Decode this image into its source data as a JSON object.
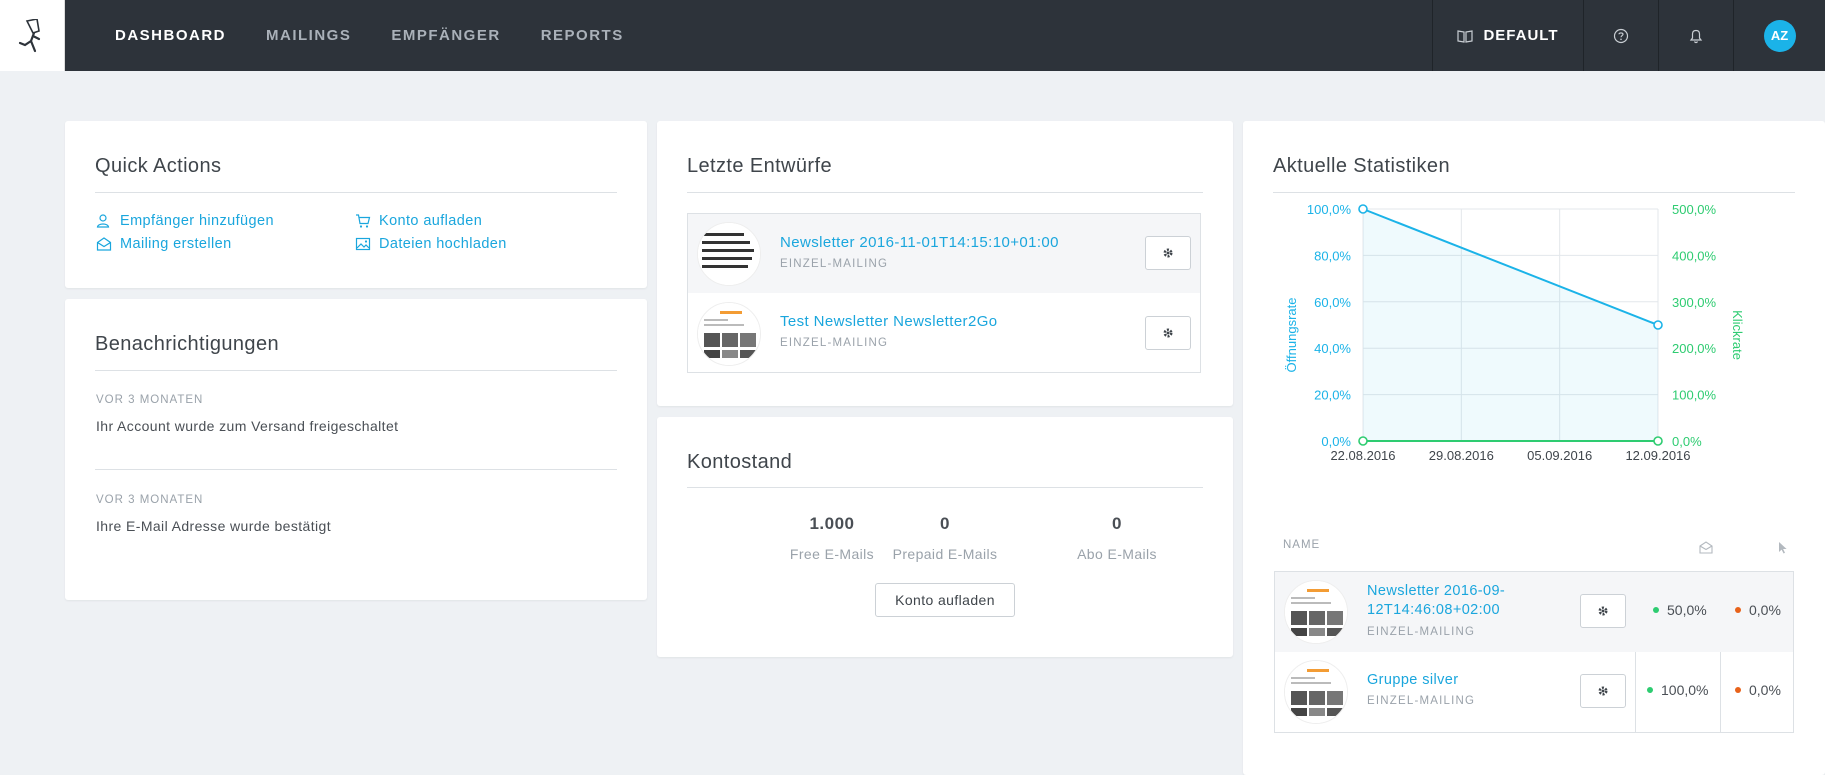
{
  "nav": {
    "items": [
      {
        "label": "DASHBOARD",
        "active": true
      },
      {
        "label": "MAILINGS",
        "active": false
      },
      {
        "label": "EMPFÄNGER",
        "active": false
      },
      {
        "label": "REPORTS",
        "active": false
      }
    ],
    "workspace_label": "DEFAULT",
    "avatar_initials": "AZ"
  },
  "quick_actions": {
    "title": "Quick Actions",
    "links": {
      "add_recipient": "Empfänger hinzufügen",
      "create_mailing": "Mailing erstellen",
      "topup": "Konto aufladen",
      "upload": "Dateien hochladen"
    }
  },
  "notifications": {
    "title": "Benachrichtigungen",
    "items": [
      {
        "time": "VOR 3 MONATEN",
        "text": "Ihr Account wurde zum Versand freigeschaltet"
      },
      {
        "time": "VOR 3 MONATEN",
        "text": "Ihre E-Mail Adresse wurde bestätigt"
      }
    ]
  },
  "drafts": {
    "title": "Letzte Entwürfe",
    "items": [
      {
        "title": "Newsletter 2016-11-01T14:15:10+01:00",
        "type": "EINZEL-MAILING"
      },
      {
        "title": "Test Newsletter Newsletter2Go",
        "type": "EINZEL-MAILING"
      }
    ]
  },
  "balance": {
    "title": "Kontostand",
    "stats": [
      {
        "value": "1.000",
        "label": "Free E-Mails"
      },
      {
        "value": "0",
        "label": "Prepaid E-Mails"
      },
      {
        "value": "0",
        "label": "Abo E-Mails"
      }
    ],
    "button_label": "Konto aufladen"
  },
  "statistics": {
    "title": "Aktuelle Statistiken",
    "table_header_name": "NAME",
    "rows": [
      {
        "title": "Newsletter 2016-09-12T14:46:08+02:00",
        "type": "EINZEL-MAILING",
        "open_rate": "50,0%",
        "click_rate": "0,0%"
      },
      {
        "title": "Gruppe silver",
        "type": "EINZEL-MAILING",
        "open_rate": "100,0%",
        "click_rate": "0,0%"
      }
    ]
  },
  "chart_data": {
    "type": "line",
    "x": [
      "22.08.2016",
      "29.08.2016",
      "05.09.2016",
      "12.09.2016"
    ],
    "series": [
      {
        "name": "Öffnungsrate",
        "axis": "left",
        "color": "#1bb3e8",
        "points": [
          {
            "x": "22.08.2016",
            "y": 100.0
          },
          {
            "x": "12.09.2016",
            "y": 50.0
          }
        ]
      },
      {
        "name": "Klickrate",
        "axis": "right",
        "color": "#2ecc71",
        "points": [
          {
            "x": "22.08.2016",
            "y": 0.0
          },
          {
            "x": "12.09.2016",
            "y": 0.0
          }
        ]
      }
    ],
    "ylabel_left": "Öffnungsrate",
    "ylabel_right": "Klickrate",
    "ylim_left": [
      0,
      100
    ],
    "ylim_right": [
      0,
      500
    ],
    "yticks_left": [
      "0,0%",
      "20,0%",
      "40,0%",
      "60,0%",
      "80,0%",
      "100,0%"
    ],
    "yticks_right": [
      "0,0%",
      "100,0%",
      "200,0%",
      "300,0%",
      "400,0%",
      "500,0%"
    ],
    "grid": true
  },
  "colors": {
    "accent": "#1aa6dd",
    "nav_bg": "#2d333a",
    "green": "#2ecc71",
    "orange": "#e8621a"
  }
}
